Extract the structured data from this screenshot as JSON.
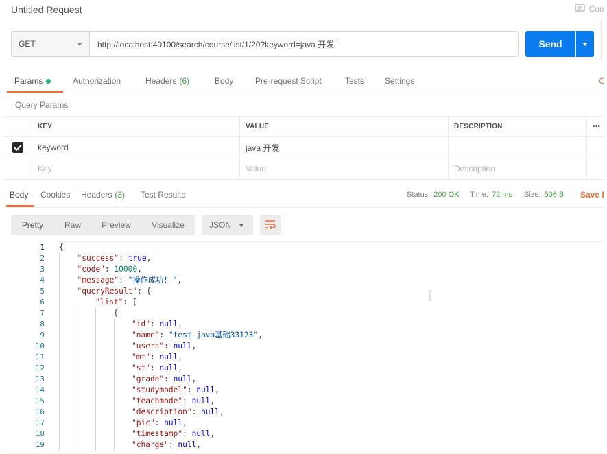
{
  "header": {
    "title": "Untitled Request",
    "comments_label": "Com"
  },
  "request": {
    "method": "GET",
    "url": "http://localhost:40100/search/course/list/1/20?keyword=java 开发",
    "send_label": "Send"
  },
  "request_tabs": [
    {
      "label": "Params",
      "count": "",
      "active": true
    },
    {
      "label": "Authorization",
      "count": ""
    },
    {
      "label": "Headers",
      "count": "(6)"
    },
    {
      "label": "Body",
      "count": ""
    },
    {
      "label": "Pre-request Script",
      "count": ""
    },
    {
      "label": "Tests",
      "count": ""
    },
    {
      "label": "Settings",
      "count": ""
    }
  ],
  "cookies_label": "C",
  "query_params": {
    "section_label": "Query Params",
    "columns": {
      "key": "KEY",
      "value": "VALUE",
      "description": "DESCRIPTION",
      "more": "•••"
    },
    "rows": [
      {
        "checked": true,
        "key": "keyword",
        "value": "java 开发",
        "description": ""
      }
    ],
    "placeholder": {
      "key": "Key",
      "value": "Value",
      "description": "Description"
    }
  },
  "response": {
    "tabs": [
      {
        "label": "Body",
        "count": "",
        "active": true
      },
      {
        "label": "Cookies",
        "count": ""
      },
      {
        "label": "Headers",
        "count": "(3)"
      },
      {
        "label": "Test Results",
        "count": ""
      }
    ],
    "status_label": "Status:",
    "status_value": "200 OK",
    "time_label": "Time:",
    "time_value": "72 ms",
    "size_label": "Size:",
    "size_value": "506 B",
    "save_label": "Save R"
  },
  "viewer": {
    "modes": [
      "Pretty",
      "Raw",
      "Preview",
      "Visualize"
    ],
    "active_mode": "Pretty",
    "format": "JSON"
  },
  "code_lines": [
    {
      "n": "1",
      "indent": 0,
      "tokens": [
        {
          "t": "p",
          "v": "{"
        }
      ]
    },
    {
      "n": "2",
      "indent": 1,
      "tokens": [
        {
          "t": "key",
          "v": "\"success\""
        },
        {
          "t": "p",
          "v": ": "
        },
        {
          "t": "lit",
          "v": "true"
        },
        {
          "t": "p",
          "v": ","
        }
      ]
    },
    {
      "n": "3",
      "indent": 1,
      "tokens": [
        {
          "t": "key",
          "v": "\"code\""
        },
        {
          "t": "p",
          "v": ": "
        },
        {
          "t": "num",
          "v": "10000"
        },
        {
          "t": "p",
          "v": ","
        }
      ]
    },
    {
      "n": "4",
      "indent": 1,
      "tokens": [
        {
          "t": "key",
          "v": "\"message\""
        },
        {
          "t": "p",
          "v": ": "
        },
        {
          "t": "str",
          "v": "\"操作成功! \""
        },
        {
          "t": "p",
          "v": ","
        }
      ]
    },
    {
      "n": "5",
      "indent": 1,
      "tokens": [
        {
          "t": "key",
          "v": "\"queryResult\""
        },
        {
          "t": "p",
          "v": ": {"
        }
      ]
    },
    {
      "n": "6",
      "indent": 2,
      "tokens": [
        {
          "t": "key",
          "v": "\"list\""
        },
        {
          "t": "p",
          "v": ": ["
        }
      ]
    },
    {
      "n": "7",
      "indent": 3,
      "tokens": [
        {
          "t": "p",
          "v": "{"
        }
      ]
    },
    {
      "n": "8",
      "indent": 4,
      "tokens": [
        {
          "t": "key",
          "v": "\"id\""
        },
        {
          "t": "p",
          "v": ": "
        },
        {
          "t": "lit",
          "v": "null"
        },
        {
          "t": "p",
          "v": ","
        }
      ]
    },
    {
      "n": "9",
      "indent": 4,
      "tokens": [
        {
          "t": "key",
          "v": "\"name\""
        },
        {
          "t": "p",
          "v": ": "
        },
        {
          "t": "str",
          "v": "\"test_java基础33123\""
        },
        {
          "t": "p",
          "v": ","
        }
      ]
    },
    {
      "n": "10",
      "indent": 4,
      "tokens": [
        {
          "t": "key",
          "v": "\"users\""
        },
        {
          "t": "p",
          "v": ": "
        },
        {
          "t": "lit",
          "v": "null"
        },
        {
          "t": "p",
          "v": ","
        }
      ]
    },
    {
      "n": "11",
      "indent": 4,
      "tokens": [
        {
          "t": "key",
          "v": "\"mt\""
        },
        {
          "t": "p",
          "v": ": "
        },
        {
          "t": "lit",
          "v": "null"
        },
        {
          "t": "p",
          "v": ","
        }
      ]
    },
    {
      "n": "12",
      "indent": 4,
      "tokens": [
        {
          "t": "key",
          "v": "\"st\""
        },
        {
          "t": "p",
          "v": ": "
        },
        {
          "t": "lit",
          "v": "null"
        },
        {
          "t": "p",
          "v": ","
        }
      ]
    },
    {
      "n": "13",
      "indent": 4,
      "tokens": [
        {
          "t": "key",
          "v": "\"grade\""
        },
        {
          "t": "p",
          "v": ": "
        },
        {
          "t": "lit",
          "v": "null"
        },
        {
          "t": "p",
          "v": ","
        }
      ]
    },
    {
      "n": "14",
      "indent": 4,
      "tokens": [
        {
          "t": "key",
          "v": "\"studymodel\""
        },
        {
          "t": "p",
          "v": ": "
        },
        {
          "t": "lit",
          "v": "null"
        },
        {
          "t": "p",
          "v": ","
        }
      ]
    },
    {
      "n": "15",
      "indent": 4,
      "tokens": [
        {
          "t": "key",
          "v": "\"teachmode\""
        },
        {
          "t": "p",
          "v": ": "
        },
        {
          "t": "lit",
          "v": "null"
        },
        {
          "t": "p",
          "v": ","
        }
      ]
    },
    {
      "n": "16",
      "indent": 4,
      "tokens": [
        {
          "t": "key",
          "v": "\"description\""
        },
        {
          "t": "p",
          "v": ": "
        },
        {
          "t": "lit",
          "v": "null"
        },
        {
          "t": "p",
          "v": ","
        }
      ]
    },
    {
      "n": "17",
      "indent": 4,
      "tokens": [
        {
          "t": "key",
          "v": "\"pic\""
        },
        {
          "t": "p",
          "v": ": "
        },
        {
          "t": "lit",
          "v": "null"
        },
        {
          "t": "p",
          "v": ","
        }
      ]
    },
    {
      "n": "18",
      "indent": 4,
      "tokens": [
        {
          "t": "key",
          "v": "\"timestamp\""
        },
        {
          "t": "p",
          "v": ": "
        },
        {
          "t": "lit",
          "v": "null"
        },
        {
          "t": "p",
          "v": ","
        }
      ]
    },
    {
      "n": "19",
      "indent": 4,
      "tokens": [
        {
          "t": "key",
          "v": "\"charge\""
        },
        {
          "t": "p",
          "v": ": "
        },
        {
          "t": "lit",
          "v": "null"
        },
        {
          "t": "p",
          "v": ","
        }
      ]
    }
  ],
  "colors": {
    "accent": "#f26b3a",
    "send": "#097bed",
    "success": "#4aa64a",
    "status_dot": "#26b47f"
  },
  "icons": {
    "comments": "comment-icon",
    "checkbox": "checkmark-icon",
    "wrap": "wrap-lines-icon",
    "more": "more-horizontal-icon"
  }
}
